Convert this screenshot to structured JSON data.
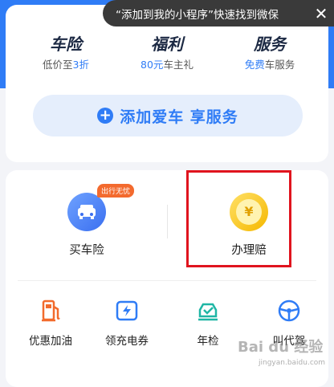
{
  "toast": {
    "text": "“添加到我的小程序”快速找到微保",
    "close": "✕"
  },
  "features": [
    {
      "title": "车险",
      "sub_pre": "低价至",
      "sub_hl": "3折",
      "sub_post": ""
    },
    {
      "title": "福利",
      "sub_pre": "",
      "sub_hl": "80元",
      "sub_post": "车主礼"
    },
    {
      "title": "服务",
      "sub_pre": "",
      "sub_hl": "免费",
      "sub_post": "车服务"
    }
  ],
  "add_car": {
    "icon": "+",
    "label": "添加爱车 享服务"
  },
  "services": [
    {
      "label": "买车险",
      "badge": "出行无忧"
    },
    {
      "label": "办理赔",
      "symbol": "¥"
    }
  ],
  "tools": [
    {
      "label": "优惠加油"
    },
    {
      "label": "领充电券"
    },
    {
      "label": "年检"
    },
    {
      "label": "叫代驾"
    }
  ],
  "watermark": {
    "main": "Bai du 经验",
    "sub": "jingyan.baidu.com"
  },
  "colors": {
    "accent": "#2f7cf6",
    "highlight_box": "#e0141e",
    "badge": "#f36a2e"
  }
}
